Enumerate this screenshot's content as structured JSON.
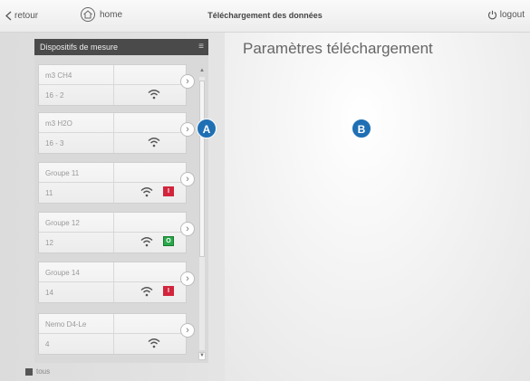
{
  "topbar": {
    "back_label": "retour",
    "home_label": "home",
    "title": "Téléchargement des données",
    "logout_label": "logout"
  },
  "panel": {
    "title": "Dispositifs de mesure",
    "devices": [
      {
        "name": "m3 CH4",
        "value": "16 - 2",
        "badge": ""
      },
      {
        "name": "m3 H2O",
        "value": "16 - 3",
        "badge": ""
      },
      {
        "name": "Groupe 11",
        "value": "11",
        "badge": "I"
      },
      {
        "name": "Groupe 12",
        "value": "12",
        "badge": "O"
      },
      {
        "name": "Groupe 14",
        "value": "14",
        "badge": "I"
      },
      {
        "name": "Nemo D4-Le",
        "value": "4",
        "badge": ""
      }
    ],
    "footer_label": "tous"
  },
  "main": {
    "title": "Paramètres téléchargement"
  },
  "markers": {
    "a": "A",
    "b": "B"
  },
  "colors": {
    "badge_red": "#d2243c",
    "badge_green": "#2aa84a",
    "marker_blue": "#1f6fb4"
  }
}
